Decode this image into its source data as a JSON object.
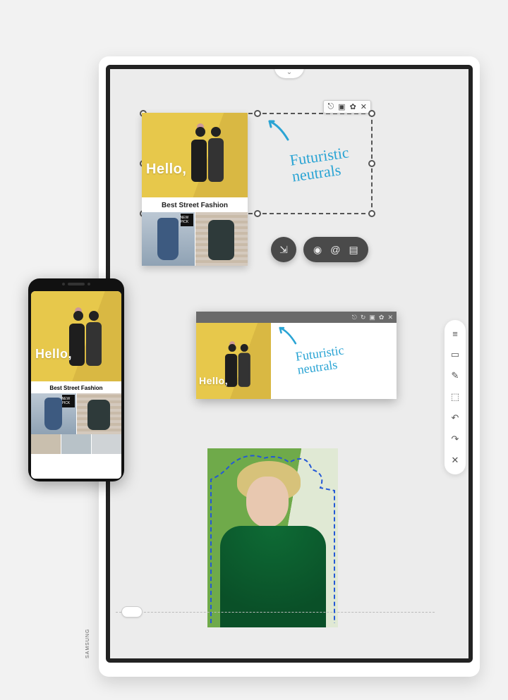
{
  "brand": "SAMSUNG",
  "hero_text": "Hello,",
  "card_heading": "Best Street Fashion",
  "thumb_tag": "NEW PICK",
  "annotation": "Futuristic\nneutrals",
  "selection_tools": {
    "lock": "⎋",
    "crop": "▣",
    "settings": "✿",
    "close": "✕"
  },
  "snapshot_tools": {
    "lock": "⎋",
    "rotate": "↻",
    "crop": "▣",
    "settings": "✿",
    "close": "✕"
  },
  "action_pill": {
    "cast": "⇲",
    "camera": "◉",
    "email": "@",
    "doc": "▤"
  },
  "sidebar": {
    "menu": "≡",
    "note": "▭",
    "edit": "✎",
    "select": "⬚",
    "undo": "↶",
    "redo": "↷",
    "close": "✕"
  },
  "expand_icon": "⌄"
}
